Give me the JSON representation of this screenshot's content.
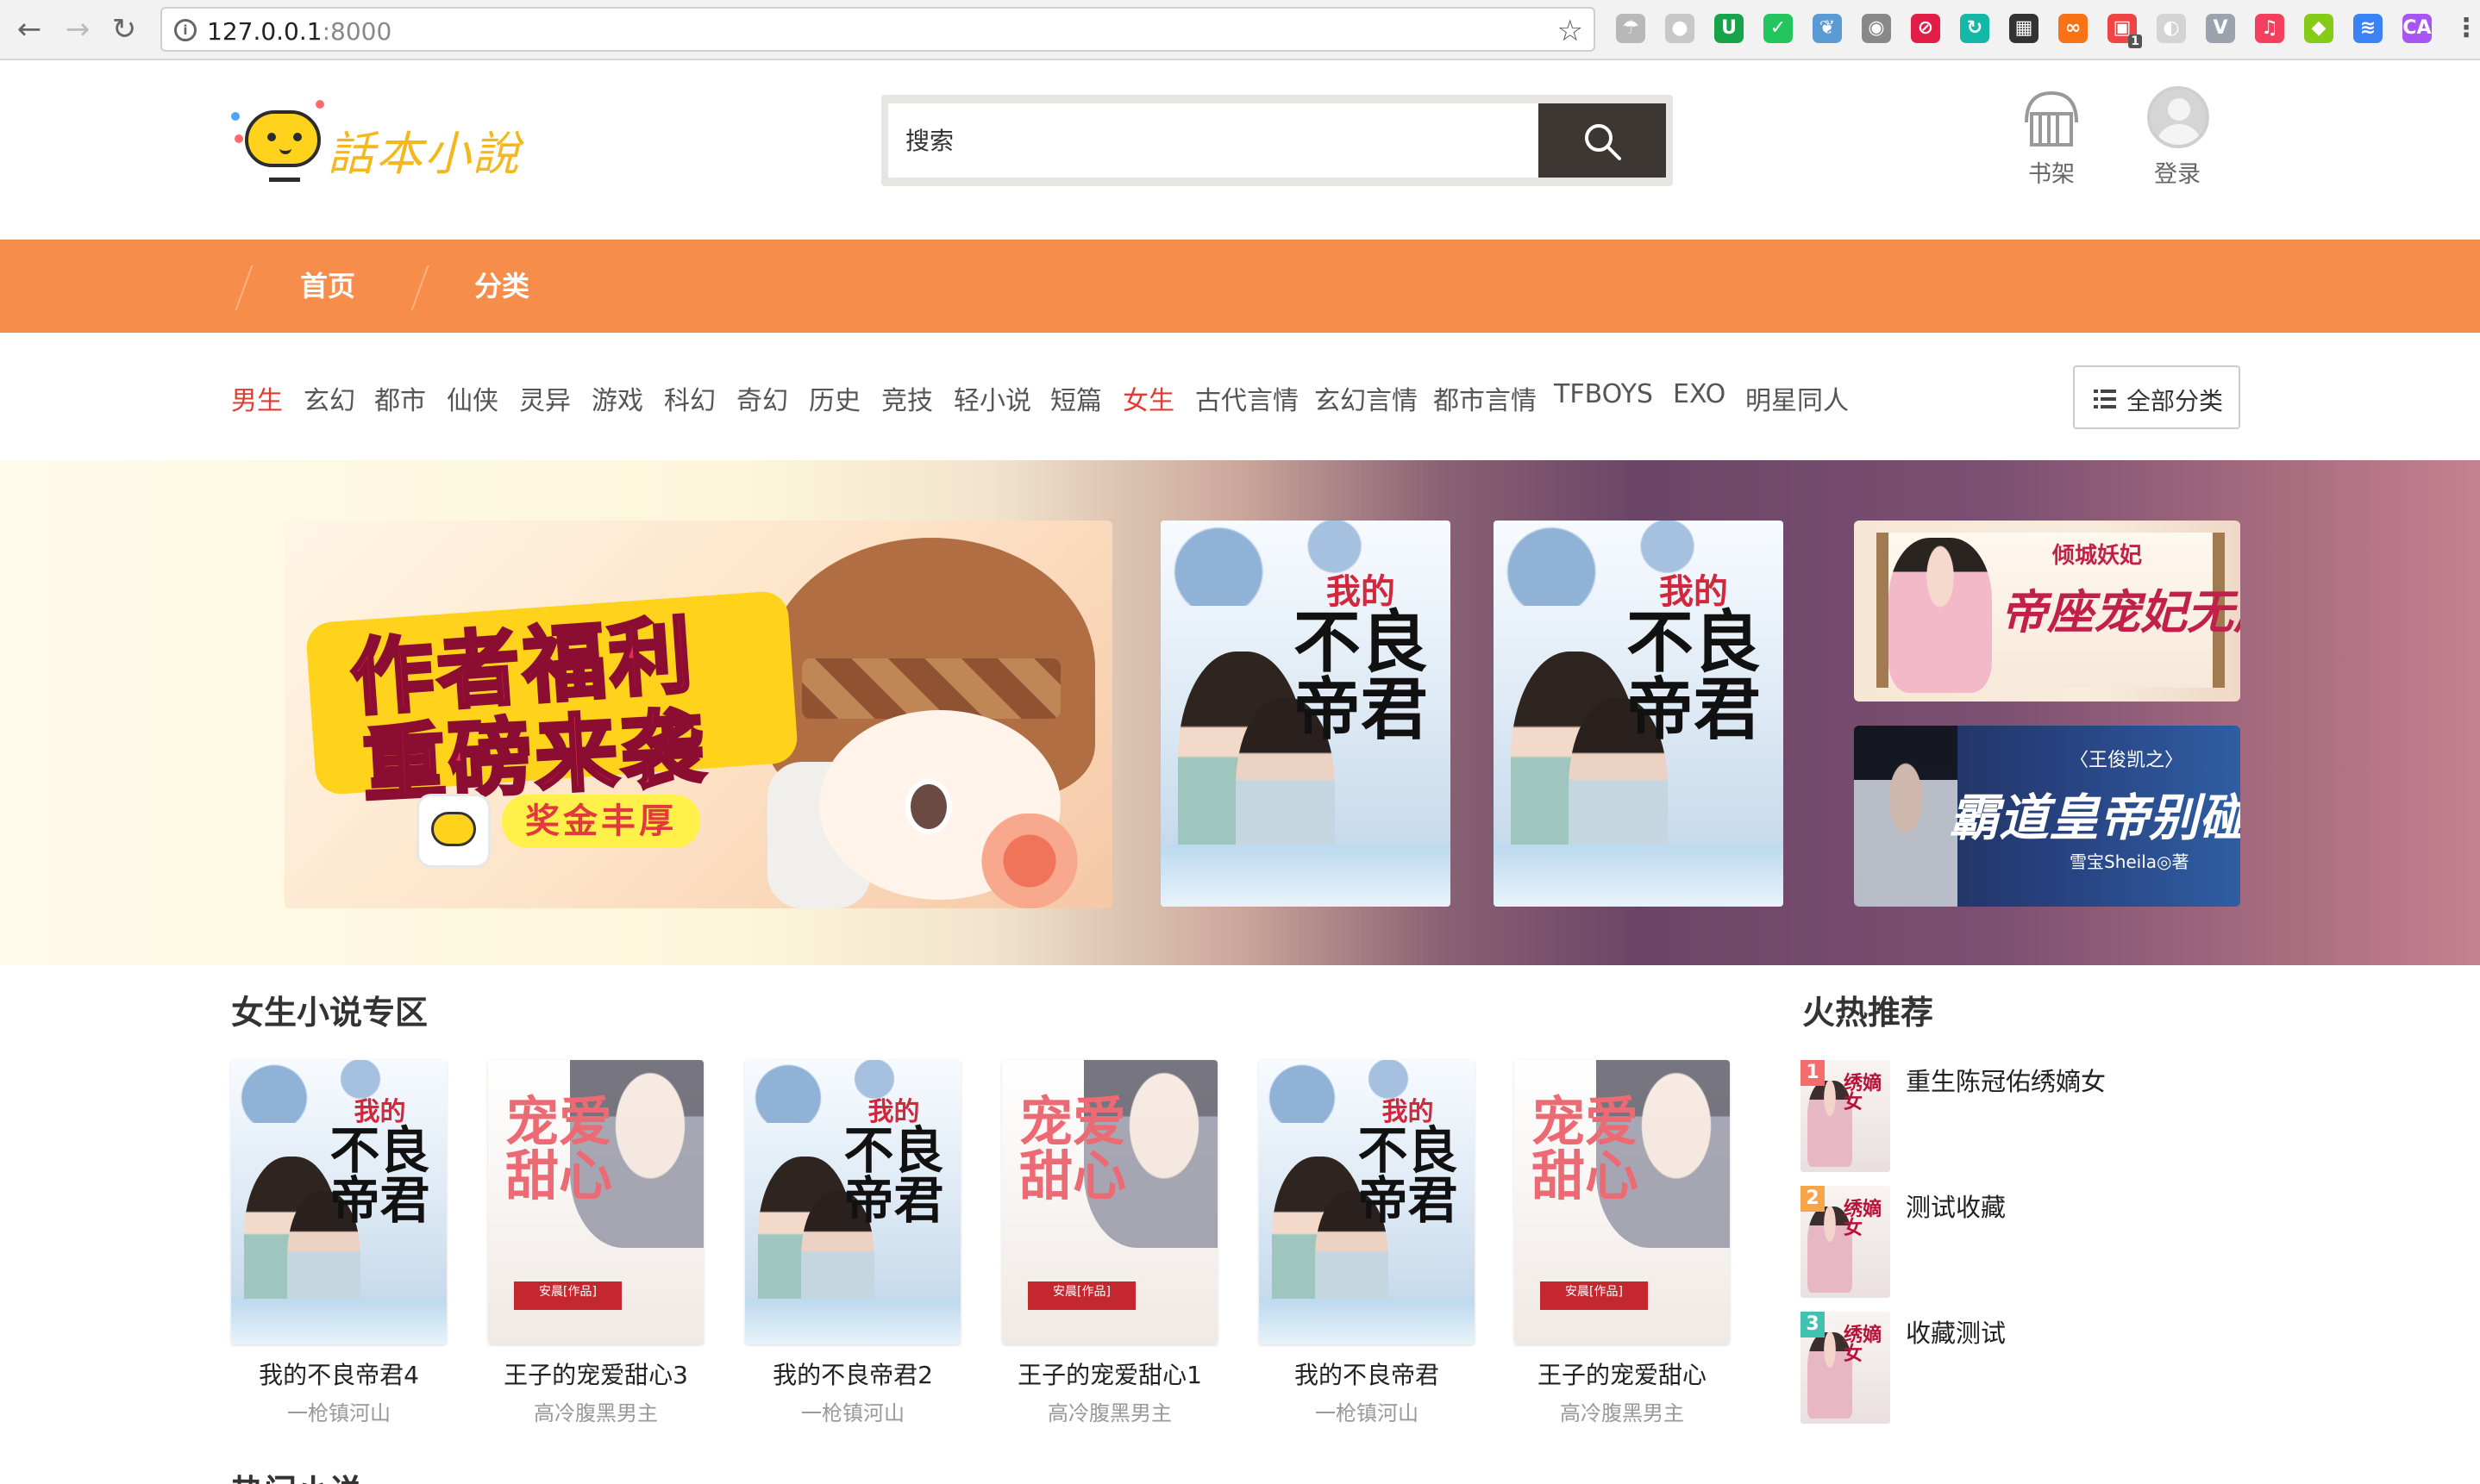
{
  "browser": {
    "url_host": "127.0.0.1",
    "url_port": ":8000",
    "extension_icons": [
      {
        "name": "umbrella-icon",
        "color": "#b8b8b8"
      },
      {
        "name": "circle-icon",
        "color": "#c8c8c8"
      },
      {
        "name": "shield-green-icon",
        "color": "#16a34a"
      },
      {
        "name": "shield-check-icon",
        "color": "#22c55e"
      },
      {
        "name": "leaf-icon",
        "color": "#5b9bd5"
      },
      {
        "name": "weibo-icon",
        "color": "#888888"
      },
      {
        "name": "adblock-icon",
        "color": "#e11d48"
      },
      {
        "name": "refresh-icon",
        "color": "#14b8a6"
      },
      {
        "name": "qrcode-icon",
        "color": "#333333"
      },
      {
        "name": "infinity-icon",
        "color": "#f97316"
      },
      {
        "name": "badge-icon",
        "color": "#ef4444"
      },
      {
        "name": "moon-icon",
        "color": "#d4d4d4"
      },
      {
        "name": "vue-icon",
        "color": "#9ca3af"
      },
      {
        "name": "music-icon",
        "color": "#f43f5e"
      },
      {
        "name": "apple-icon",
        "color": "#84cc16"
      },
      {
        "name": "layers-icon",
        "color": "#3b82f6"
      },
      {
        "name": "ca-icon",
        "color": "#a855f7"
      },
      {
        "name": "menu-icon",
        "color": "#555555"
      }
    ],
    "badge_count": "1"
  },
  "header": {
    "logo_text": "話本小說",
    "search_placeholder": "搜索",
    "bookshelf_label": "书架",
    "login_label": "登录"
  },
  "nav": {
    "tabs": [
      "首页",
      "分类"
    ],
    "accent": "#f78d4a"
  },
  "categories": {
    "items": [
      {
        "label": "男生",
        "highlight": true
      },
      {
        "label": "玄幻",
        "highlight": false
      },
      {
        "label": "都市",
        "highlight": false
      },
      {
        "label": "仙侠",
        "highlight": false
      },
      {
        "label": "灵异",
        "highlight": false
      },
      {
        "label": "游戏",
        "highlight": false
      },
      {
        "label": "科幻",
        "highlight": false
      },
      {
        "label": "奇幻",
        "highlight": false
      },
      {
        "label": "历史",
        "highlight": false
      },
      {
        "label": "竞技",
        "highlight": false
      },
      {
        "label": "轻小说",
        "highlight": false
      },
      {
        "label": "短篇",
        "highlight": false
      },
      {
        "label": "女生",
        "highlight": true
      },
      {
        "label": "古代言情",
        "highlight": false
      },
      {
        "label": "玄幻言情",
        "highlight": false
      },
      {
        "label": "都市言情",
        "highlight": false
      },
      {
        "label": "TFBOYS",
        "highlight": false
      },
      {
        "label": "EXO",
        "highlight": false
      },
      {
        "label": "明星同人",
        "highlight": false
      }
    ],
    "all_label": "全部分类"
  },
  "banner": {
    "promo_line1": "作者福利",
    "promo_line2": "重磅来袭",
    "promo_pill": "奖金丰厚",
    "cover_title_pre": "我的",
    "cover_title": "不良帝君",
    "side1_title": "帝座宠妃无度",
    "side1_sub": "倾城妖妃",
    "side2_title": "霸道皇帝别碰我",
    "side2_sub": "〈王俊凯之〉",
    "side2_author": "雪宝Sheila◎著"
  },
  "girls_section": {
    "title": "女生小说专区",
    "books": [
      {
        "name": "我的不良帝君4",
        "author": "一枪镇河山",
        "cover": "a"
      },
      {
        "name": "王子的宠爱甜心3",
        "author": "高冷腹黑男主",
        "cover": "b"
      },
      {
        "name": "我的不良帝君2",
        "author": "一枪镇河山",
        "cover": "a"
      },
      {
        "name": "王子的宠爱甜心1",
        "author": "高冷腹黑男主",
        "cover": "b"
      },
      {
        "name": "我的不良帝君",
        "author": "一枪镇河山",
        "cover": "a"
      },
      {
        "name": "王子的宠爱甜心",
        "author": "高冷腹黑男主",
        "cover": "b"
      }
    ],
    "cover_b_title": "宠爱甜心",
    "cover_b_badge": "安晨[作品]"
  },
  "hot_section": {
    "title": "火热推荐",
    "items": [
      {
        "rank": "1",
        "name": "重生陈冠佑绣嫡女",
        "rank_color": "#f56c6c"
      },
      {
        "rank": "2",
        "name": "测试收藏",
        "rank_color": "#f7a54a"
      },
      {
        "rank": "3",
        "name": "收藏测试",
        "rank_color": "#3fc2b0"
      }
    ],
    "cover_title": "绣嫡女"
  },
  "next_section": {
    "title": "热门小说"
  }
}
